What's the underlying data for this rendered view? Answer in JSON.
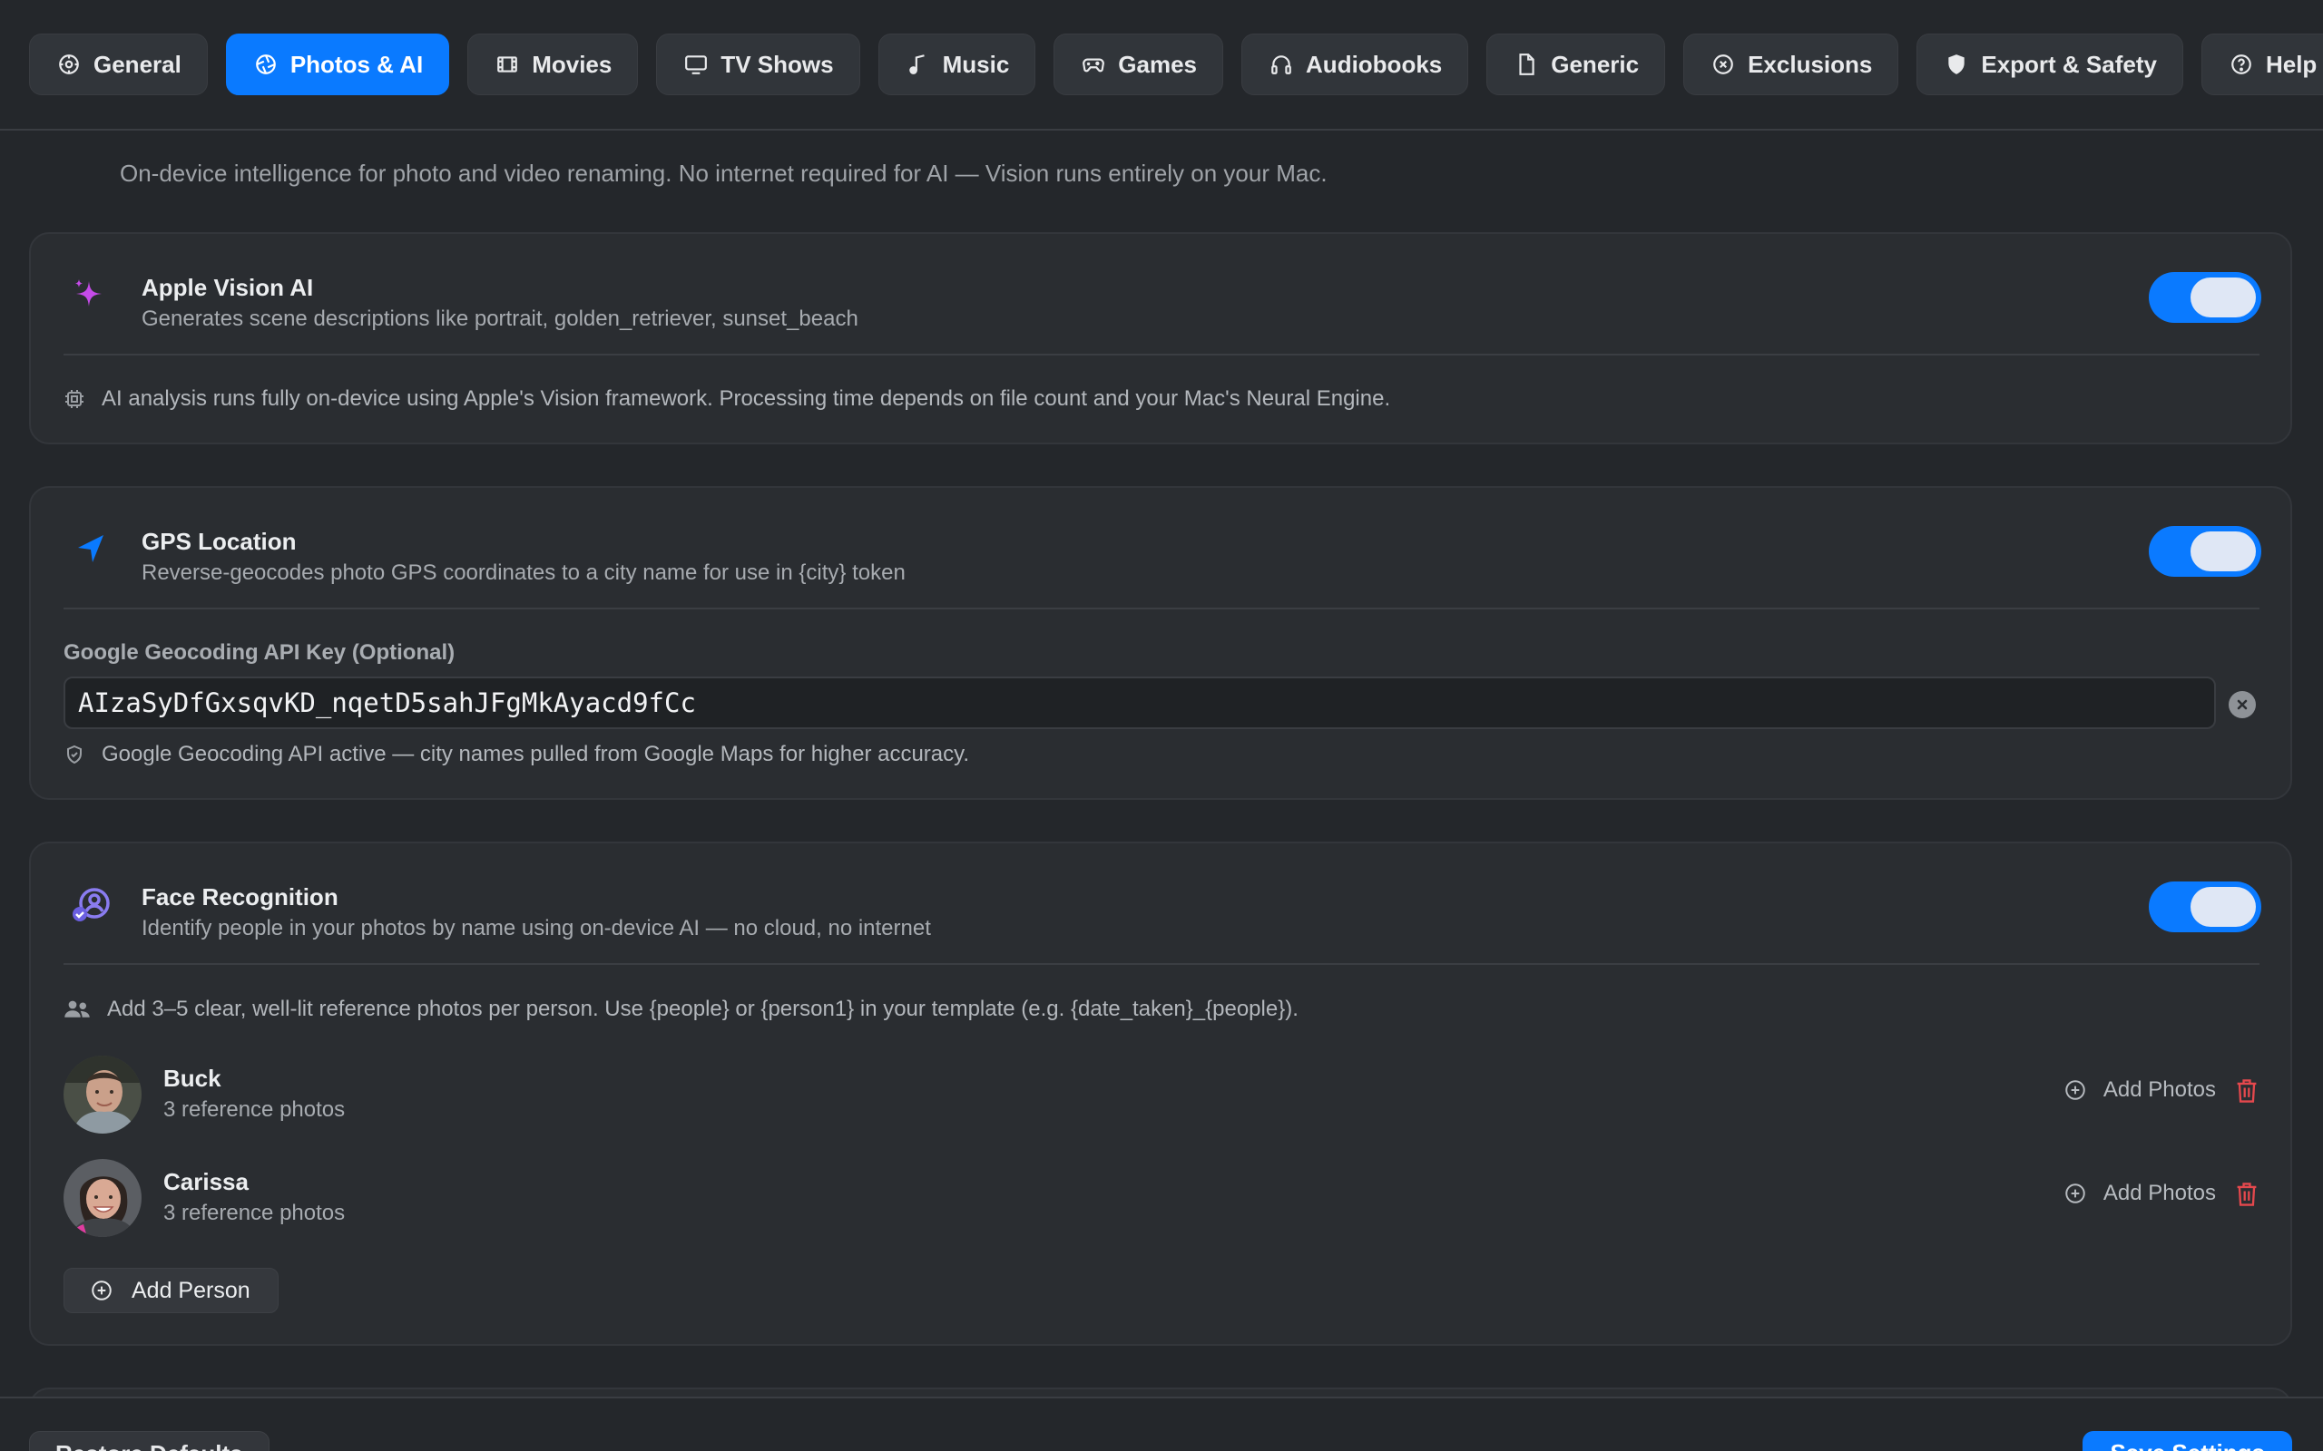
{
  "tabs": [
    {
      "label": "General",
      "icon": "gear-icon",
      "active": false
    },
    {
      "label": "Photos & AI",
      "icon": "aperture-icon",
      "active": true
    },
    {
      "label": "Movies",
      "icon": "film-icon",
      "active": false
    },
    {
      "label": "TV Shows",
      "icon": "tv-icon",
      "active": false
    },
    {
      "label": "Music",
      "icon": "music-note-icon",
      "active": false
    },
    {
      "label": "Games",
      "icon": "gamecontroller-icon",
      "active": false
    },
    {
      "label": "Audiobooks",
      "icon": "headphones-icon",
      "active": false
    },
    {
      "label": "Generic",
      "icon": "document-icon",
      "active": false
    },
    {
      "label": "Exclusions",
      "icon": "x-circle-icon",
      "active": false
    },
    {
      "label": "Export & Safety",
      "icon": "shield-icon",
      "active": false
    },
    {
      "label": "Help",
      "icon": "question-circle-icon",
      "active": false
    }
  ],
  "intro": "On-device intelligence for photo and video renaming. No internet required for AI — Vision runs entirely on your Mac.",
  "vision": {
    "title": "Apple Vision AI",
    "subtitle": "Generates scene descriptions like portrait, golden_retriever, sunset_beach",
    "enabled": true,
    "note": "AI analysis runs fully on-device using Apple's Vision framework. Processing time depends on file count and your Mac's Neural Engine."
  },
  "gps": {
    "title": "GPS Location",
    "subtitle": "Reverse-geocodes photo GPS coordinates to a city name for use in {city} token",
    "enabled": true,
    "api_key_label": "Google Geocoding API Key (Optional)",
    "api_key_value": "AIzaSyDfGxsqvKD_nqetD5sahJFgMkAyacd9fCc",
    "status": "Google Geocoding API active — city names pulled from Google Maps for higher accuracy."
  },
  "faces": {
    "title": "Face Recognition",
    "subtitle": "Identify people in your photos by name using on-device AI — no cloud, no internet",
    "enabled": true,
    "hint": "Add 3–5 clear, well-lit reference photos per person. Use {people} or {person1} in your template (e.g. {date_taken}_{people}).",
    "people": [
      {
        "name": "Buck",
        "count": "3 reference photos",
        "add_label": "Add Photos"
      },
      {
        "name": "Carissa",
        "count": "3 reference photos",
        "add_label": "Add Photos"
      }
    ],
    "add_person_label": "Add Person"
  },
  "footer": {
    "restore_label": "Restore Defaults",
    "save_label": "Save Settings"
  },
  "colors": {
    "accent": "#0a7aff",
    "background": "#24272b",
    "card": "#2a2d31",
    "danger": "#e5484d",
    "sparkle": "#c54be8"
  }
}
